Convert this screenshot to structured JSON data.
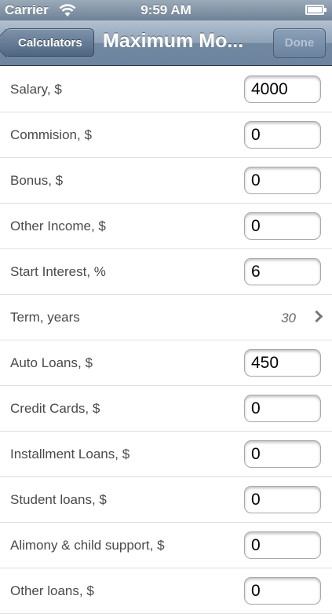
{
  "status_bar": {
    "carrier": "Carrier",
    "time": "9:59 AM"
  },
  "nav": {
    "back_label": "Calculators",
    "title": "Maximum Mo...",
    "done_label": "Done"
  },
  "form": {
    "salary": {
      "label": "Salary, $",
      "value": "4000"
    },
    "commision": {
      "label": "Commision, $",
      "value": "0"
    },
    "bonus": {
      "label": "Bonus, $",
      "value": "0"
    },
    "other_income": {
      "label": "Other Income, $",
      "value": "0"
    },
    "start_interest": {
      "label": "Start Interest, %",
      "value": "6"
    },
    "term": {
      "label": "Term, years",
      "value": "30"
    },
    "auto_loans": {
      "label": "Auto Loans, $",
      "value": "450"
    },
    "credit_cards": {
      "label": "Credit Cards, $",
      "value": "0"
    },
    "installment_loans": {
      "label": "Installment Loans, $",
      "value": "0"
    },
    "student_loans": {
      "label": "Student loans, $",
      "value": "0"
    },
    "alimony": {
      "label": "Alimony & child support, $",
      "value": "0"
    },
    "other_loans": {
      "label": "Other loans, $",
      "value": "0"
    }
  }
}
